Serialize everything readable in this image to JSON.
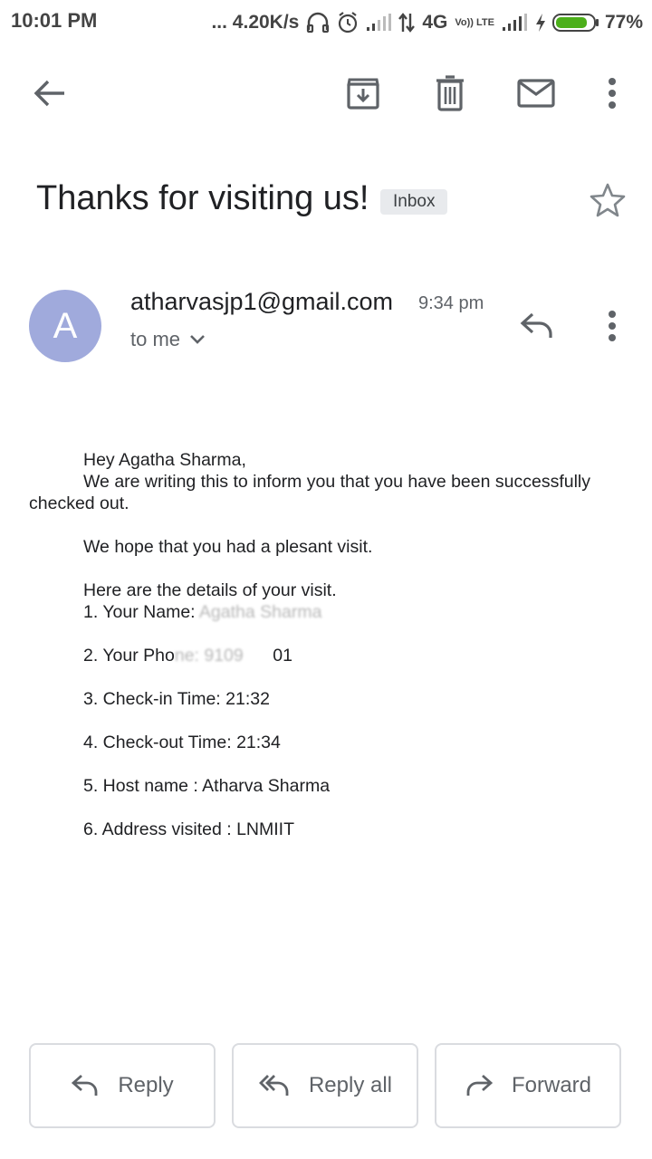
{
  "status_bar": {
    "time": "10:01 PM",
    "net_speed": "... 4.20K/s",
    "network": "4G",
    "volte": "Vo)) LTE",
    "battery": "77%"
  },
  "toolbar": {
    "icons": [
      "back-arrow-icon",
      "archive-icon",
      "delete-icon",
      "mark-unread-icon",
      "more-vert-icon"
    ]
  },
  "email": {
    "subject": "Thanks for visiting us!",
    "label": "Inbox",
    "sender": "atharvasjp1@gmail.com",
    "avatar_letter": "A",
    "time": "9:34 pm",
    "recipient": "to me",
    "body": {
      "greeting": "Hey Agatha Sharma,",
      "line1": "We are writing this to inform you that you have been successfully",
      "line1_cont": "checked out.",
      "line2": "We hope that you had a plesant visit.",
      "line3": "Here are the details of your visit.",
      "name_label": "1. Your Name: ",
      "name_value": "Agatha Sharma",
      "phone_label": "2. Your Pho",
      "phone_value": "ne: 9109",
      "phone_value_end": "01",
      "checkin": "3. Check-in Time: 21:32",
      "checkout": "4. Check-out Time: 21:34",
      "host": "5. Host name : Atharva Sharma",
      "address": "6. Address visited : LNMIIT"
    }
  },
  "actions": {
    "reply": "Reply",
    "reply_all": "Reply all",
    "forward": "Forward"
  },
  "colors": {
    "avatar": "#a0aadc",
    "chip": "#e8eaed",
    "battery": "#4caf1a"
  }
}
